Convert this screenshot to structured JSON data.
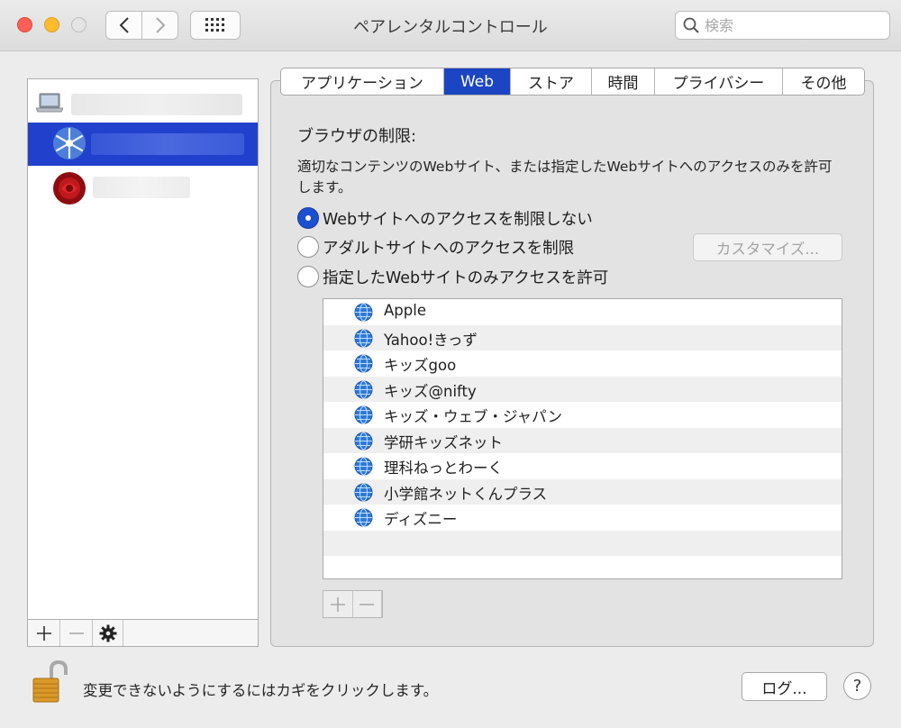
{
  "window": {
    "title": "ペアレンタルコントロール"
  },
  "search": {
    "placeholder": "検索"
  },
  "tabs": [
    {
      "label": "アプリケーション",
      "active": false
    },
    {
      "label": "Web",
      "active": true
    },
    {
      "label": "ストア",
      "active": false
    },
    {
      "label": "時間",
      "active": false
    },
    {
      "label": "プライバシー",
      "active": false
    },
    {
      "label": "その他",
      "active": false
    }
  ],
  "web": {
    "section_title": "ブラウザの制限:",
    "description": "適切なコンテンツのWebサイト、または指定したWebサイトへのアクセスのみを許可します。",
    "options": [
      {
        "label": "Webサイトへのアクセスを制限しない",
        "selected": true
      },
      {
        "label": "アダルトサイトへのアクセスを制限",
        "selected": false
      },
      {
        "label": "指定したWebサイトのみアクセスを許可",
        "selected": false
      }
    ],
    "customize_label": "カスタマイズ...",
    "sites": [
      "Apple",
      "Yahoo!きっず",
      "キッズgoo",
      "キッズ@nifty",
      "キッズ・ウェブ・ジャパン",
      "学研キッズネット",
      "理科ねっとわーく",
      "小学館ネットくんプラス",
      "ディズニー"
    ]
  },
  "footer": {
    "lock_text": "変更できないようにするにはカギをクリックします。",
    "log_label": "ログ...",
    "help_label": "?"
  },
  "colors": {
    "selection": "#2141cd",
    "tab_active": "#1b45c2",
    "radio_on": "#1d4fd1"
  }
}
